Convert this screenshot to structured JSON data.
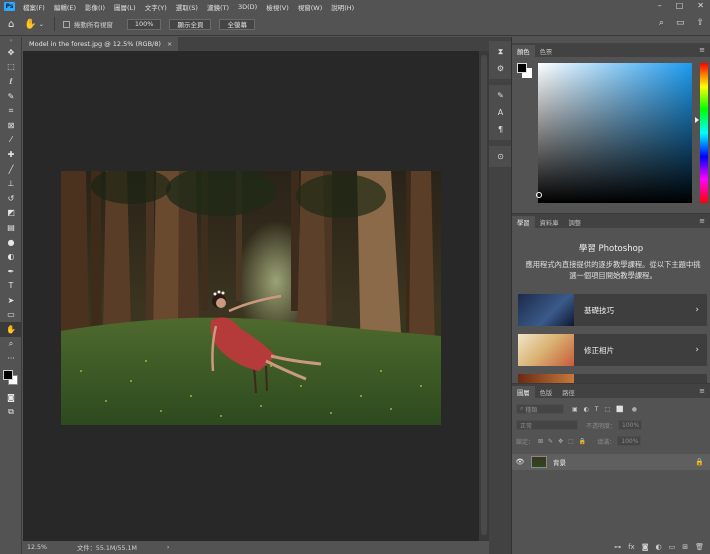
{
  "menu": {
    "items": [
      "檔案(F)",
      "編輯(E)",
      "影像(I)",
      "圖層(L)",
      "文字(Y)",
      "選取(S)",
      "濾鏡(T)",
      "3D(D)",
      "檢視(V)",
      "視窗(W)",
      "說明(H)"
    ]
  },
  "options": {
    "scroll_all_label": "捲動所有視窗",
    "zoom_value": "100%",
    "fit_screen_label": "顯示全頁",
    "fill_screen_label": "全螢幕"
  },
  "document": {
    "tab_title": "Model in the forest.jpg @ 12.5% (RGB/8)",
    "close_glyph": "×"
  },
  "status": {
    "zoom": "12.5%",
    "doc_size": "文件：55.1M/55.1M",
    "arrow": "›"
  },
  "color_panel": {
    "tabs": [
      "顏色",
      "色票"
    ],
    "accent": "#1d9bf0"
  },
  "learn_panel": {
    "tabs": [
      "學習",
      "資料庫",
      "調整"
    ],
    "title": "學習 Photoshop",
    "description": "應用程式內直接提供的逐步教學課程。從以下主題中挑選一個項目開始教學課程。",
    "cards": [
      {
        "label": "基礎技巧"
      },
      {
        "label": "修正相片"
      },
      {
        "label": ""
      }
    ]
  },
  "layers_panel": {
    "tabs": [
      "圖層",
      "色版",
      "路徑"
    ],
    "filter_label": "種類",
    "blend_mode": "正常",
    "opacity_label": "不透明度：",
    "opacity_value": "100%",
    "lock_label": "鎖定：",
    "fill_label": "填滿：",
    "fill_value": "100%",
    "layer_name": "背景"
  }
}
